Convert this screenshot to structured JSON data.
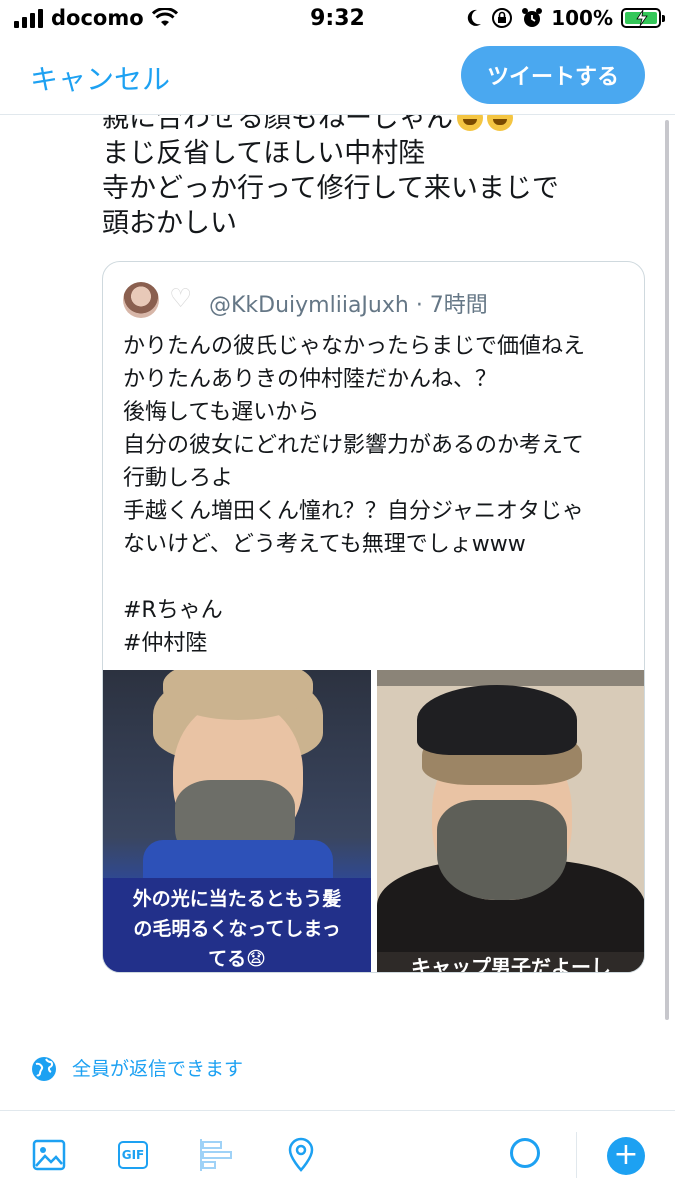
{
  "status_bar": {
    "carrier": "docomo",
    "time": "9:32",
    "battery_percent": "100%",
    "signal_bars": 4,
    "battery_level": 1.0
  },
  "header": {
    "cancel_label": "キャンセル",
    "tweet_label": "ツイートする"
  },
  "compose": {
    "lines": [
      "親に合わせる顔もねーじゃん",
      "まじ反省してほしい中村陸",
      "寺かどっか行って修行して来いまじで",
      "頭おかしい"
    ]
  },
  "quoted_tweet": {
    "handle_time": "@KkDuiymliiaJuxh · 7時間",
    "lines": [
      "かりたんの彼氏じゃなかったらまじで価値ねえ",
      "かりたんありきの仲村陸だかんね、？",
      "後悔しても遅いから",
      "自分の彼女にどれだけ影響力があるのか考えて",
      "行動しろよ",
      "手越くん増田くん憧れ？？自分ジャニオタじゃ",
      "ないけど、どう考えても無理でしょwww",
      "",
      "#Rちゃん",
      "#仲村陸"
    ],
    "media": {
      "left_caption_line1": "外の光に当たるともう髪",
      "left_caption_line2": "の毛明るくなってしまっ",
      "left_caption_line3": "てる😧",
      "right_caption": "キャップ男子だよーし"
    }
  },
  "reply_setting": {
    "label": "全員が返信できます"
  },
  "toolbar": {
    "gif_label": "GIF",
    "add_label": "+"
  },
  "colors": {
    "accent": "#1da1f2",
    "tweet_button": "#4aa8f0",
    "battery": "#34c759"
  },
  "icons": [
    "signal-icon",
    "wifi-icon",
    "moon-icon",
    "lock-rotation-icon",
    "alarm-icon",
    "battery-icon",
    "globe-icon",
    "image-icon",
    "gif-icon",
    "poll-icon",
    "location-icon",
    "add-icon"
  ]
}
